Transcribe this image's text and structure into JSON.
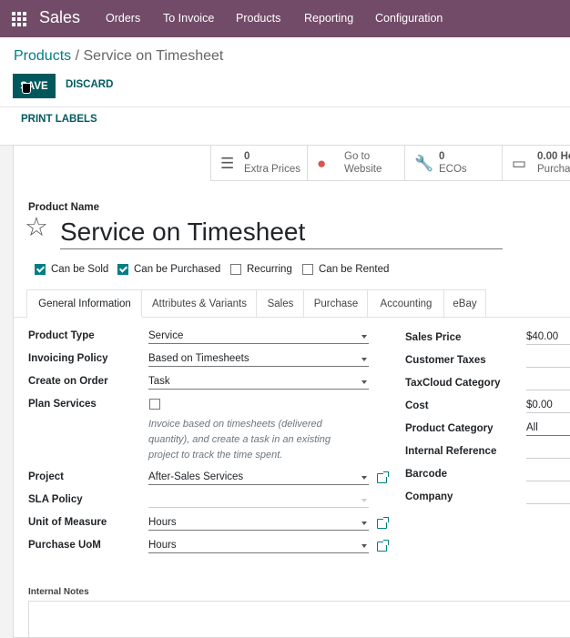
{
  "navbar": {
    "brand": "Sales",
    "menu": [
      "Orders",
      "To Invoice",
      "Products",
      "Reporting",
      "Configuration"
    ]
  },
  "breadcrumb": {
    "parent": "Products",
    "separator": "/",
    "current": "Service on Timesheet"
  },
  "buttons": {
    "save": "SAVE",
    "discard": "DISCARD",
    "print_labels": "PRINT LABELS"
  },
  "smart_buttons": [
    {
      "value": "0",
      "label": "Extra Prices",
      "icon": "list-icon"
    },
    {
      "value": "Go to",
      "label": "Website",
      "icon": "globe-icon"
    },
    {
      "value": "0",
      "label": "ECOs",
      "icon": "wrench-icon"
    },
    {
      "value": "0.00 Ho",
      "label": "Purchas",
      "icon": "credit-card-icon"
    }
  ],
  "product": {
    "name_label": "Product Name",
    "name": "Service on Timesheet",
    "flags": [
      {
        "label": "Can be Sold",
        "checked": true
      },
      {
        "label": "Can be Purchased",
        "checked": true
      },
      {
        "label": "Recurring",
        "checked": false
      },
      {
        "label": "Can be Rented",
        "checked": false
      }
    ]
  },
  "tabs": [
    "General Information",
    "Attributes & Variants",
    "Sales",
    "Purchase",
    "Accounting",
    "eBay"
  ],
  "general": {
    "product_type": {
      "label": "Product Type",
      "value": "Service"
    },
    "invoicing_policy": {
      "label": "Invoicing Policy",
      "value": "Based on Timesheets"
    },
    "create_on_order": {
      "label": "Create on Order",
      "value": "Task"
    },
    "plan_services": {
      "label": "Plan Services",
      "checked": false
    },
    "help_text": "Invoice based on timesheets (delivered quantity), and create a task in an existing project to track the time spent.",
    "project": {
      "label": "Project",
      "value": "After-Sales Services"
    },
    "sla_policy": {
      "label": "SLA Policy",
      "value": ""
    },
    "uom": {
      "label": "Unit of Measure",
      "value": "Hours"
    },
    "purchase_uom": {
      "label": "Purchase UoM",
      "value": "Hours"
    }
  },
  "right": {
    "sales_price": {
      "label": "Sales Price",
      "value": "$40.00"
    },
    "customer_taxes": {
      "label": "Customer Taxes",
      "value": ""
    },
    "taxcloud_category": {
      "label": "TaxCloud Category",
      "value": ""
    },
    "cost": {
      "label": "Cost",
      "value": "$0.00"
    },
    "product_category": {
      "label": "Product Category",
      "value": "All"
    },
    "internal_reference": {
      "label": "Internal Reference",
      "value": ""
    },
    "barcode": {
      "label": "Barcode",
      "value": ""
    },
    "company": {
      "label": "Company",
      "value": ""
    }
  },
  "internal_notes_label": "Internal Notes",
  "colors": {
    "navbar": "#714b67",
    "primary": "#017e84",
    "save": "#00585c"
  }
}
